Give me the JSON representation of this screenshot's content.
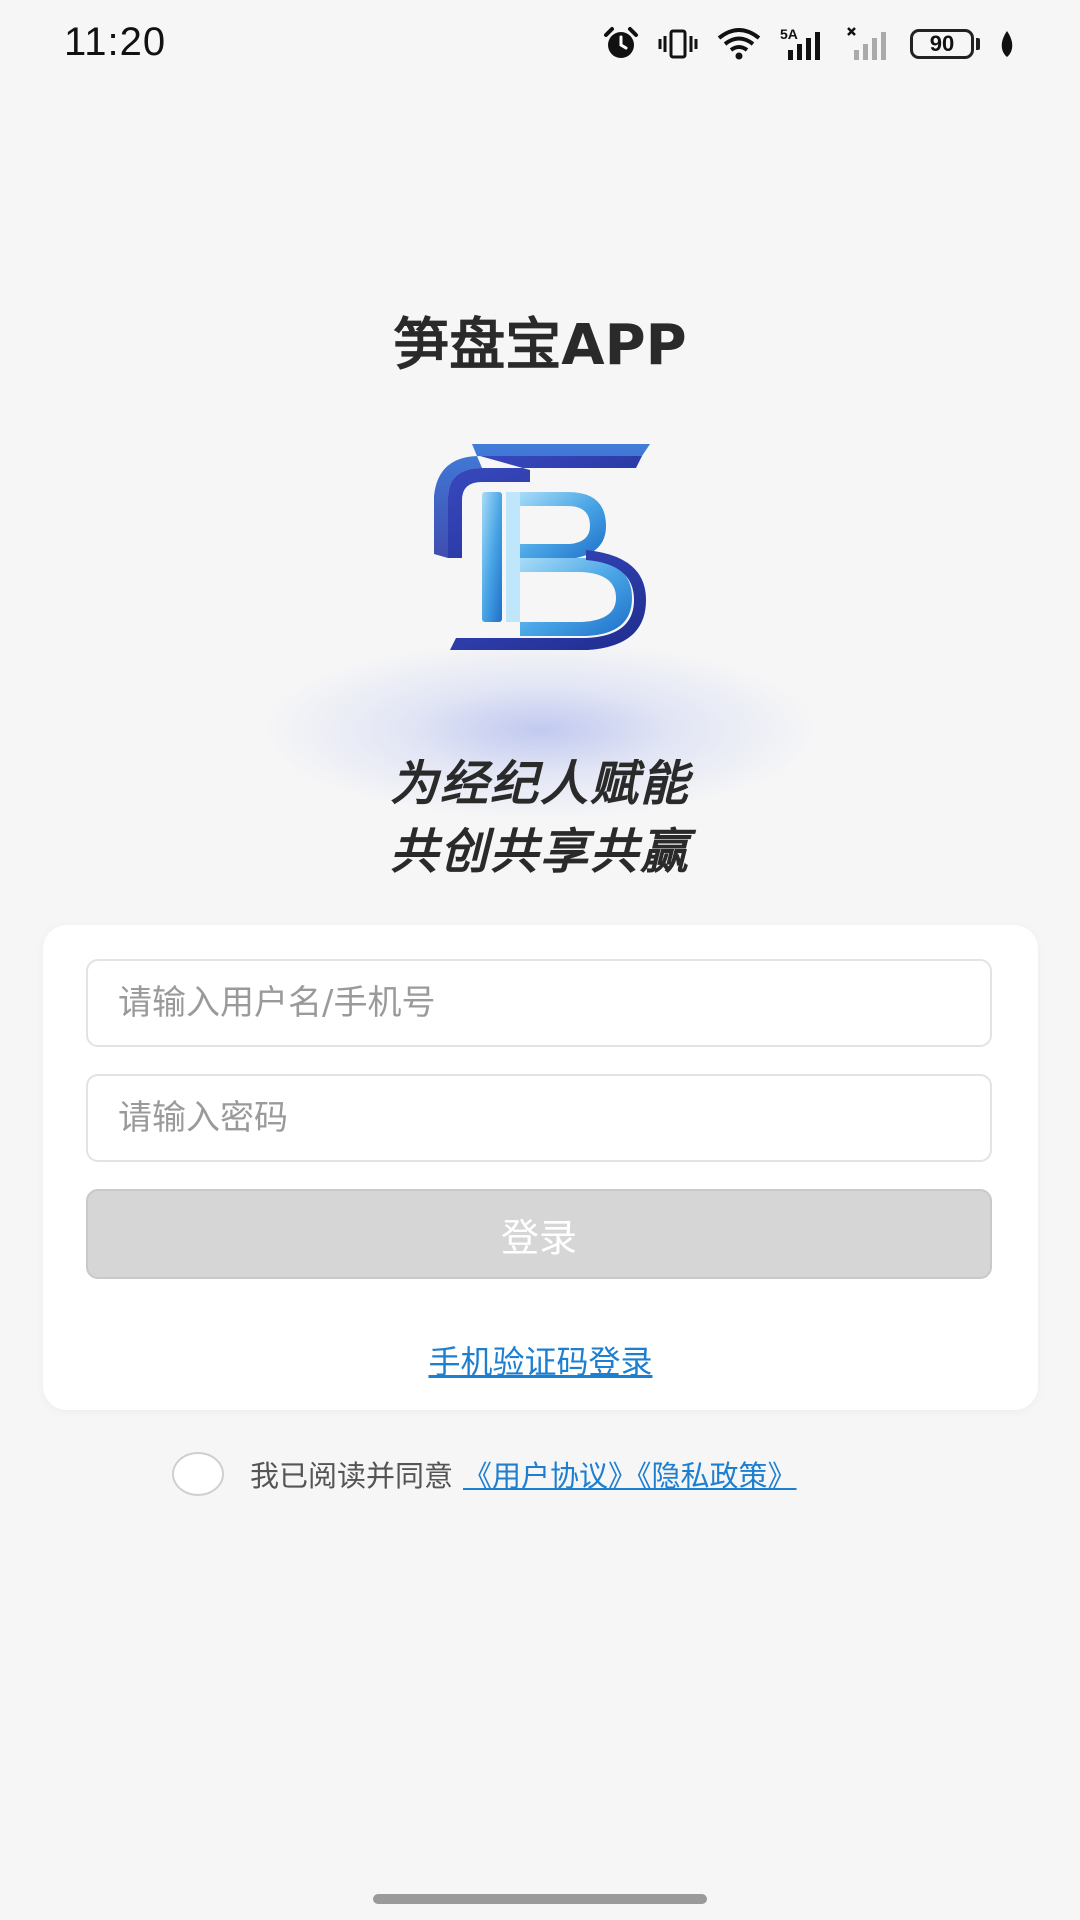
{
  "status_bar": {
    "time": "11:20",
    "battery": "90",
    "icons": [
      "alarm-icon",
      "vibrate-icon",
      "wifi-icon",
      "5g-signal-icon",
      "no-signal-icon",
      "battery-icon",
      "leaf-icon"
    ],
    "network_label": "5A"
  },
  "app": {
    "title": "笋盘宝APP",
    "slogan_line1": "为经纪人赋能",
    "slogan_line2": "共创共享共赢"
  },
  "login": {
    "username_placeholder": "请输入用户名/手机号",
    "password_placeholder": "请输入密码",
    "login_label": "登录",
    "sms_login_label": "手机验证码登录"
  },
  "agreement": {
    "text": "我已阅读并同意",
    "links": "《用户协议》《隐私政策》"
  },
  "colors": {
    "link": "#1e7fd0",
    "button_disabled": "#d6d6d6",
    "logo_dark": "#2b3aa8",
    "logo_light": "#6fc0ee"
  }
}
